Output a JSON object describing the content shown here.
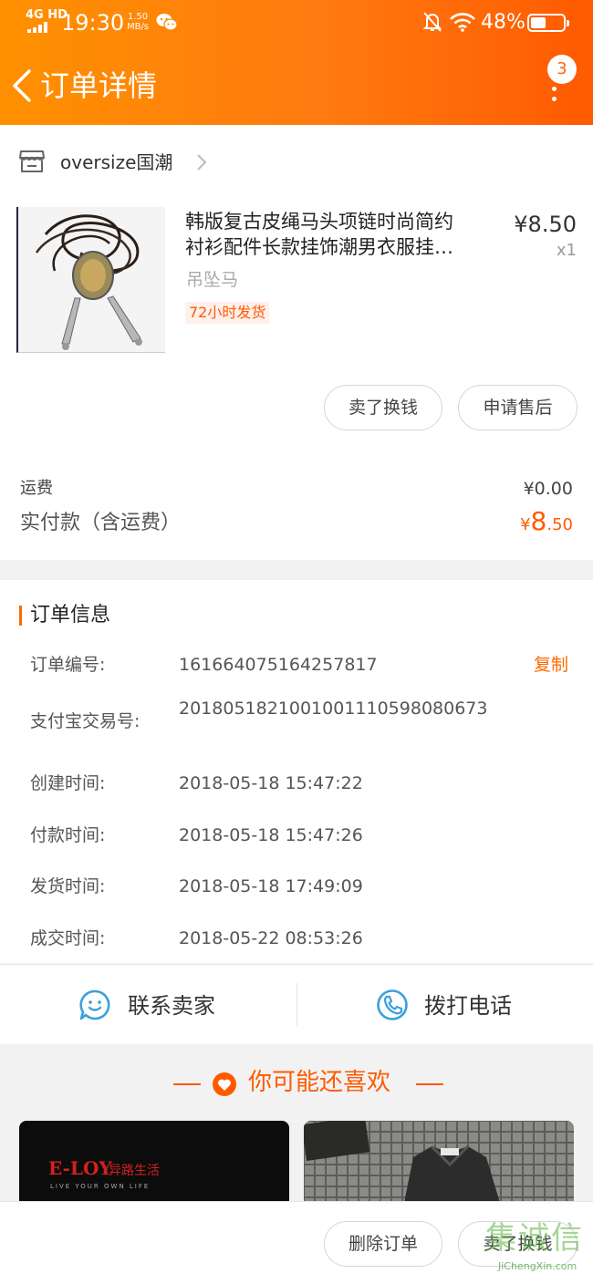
{
  "status_bar": {
    "network": "4G HD",
    "time": "19:30",
    "speed_value": "1.50",
    "speed_unit": "MB/s",
    "battery": "48%",
    "battery_level": 0.48
  },
  "nav": {
    "title": "订单详情",
    "badge": "3"
  },
  "shop": {
    "name": "oversize国潮"
  },
  "product": {
    "title_line1": "韩版复古皮绳马头项链时尚简约",
    "title_line2": "衬衫配件长款挂饰潮男衣服挂…",
    "price": "¥8.50",
    "quantity": "x1",
    "sku": "吊坠马",
    "tag": "72小时发货"
  },
  "actions": {
    "sell": "卖了换钱",
    "after_sales": "申请售后"
  },
  "summary": {
    "shipping_label": "运费",
    "shipping_value": "¥0.00",
    "paid_label": "实付款（含运费）",
    "paid_currency": "¥",
    "paid_int": "8",
    "paid_dec": ".50"
  },
  "order_info": {
    "heading": "订单信息",
    "copy_label": "复制",
    "rows": [
      {
        "label": "订单编号:",
        "value": "161664075164257817"
      },
      {
        "label": "支付宝交易号:",
        "value": "2018051821001001110598080673"
      },
      {
        "label": "创建时间:",
        "value": "2018-05-18 15:47:22"
      },
      {
        "label": "付款时间:",
        "value": "2018-05-18 15:47:26"
      },
      {
        "label": "发货时间:",
        "value": "2018-05-18 17:49:09"
      },
      {
        "label": "成交时间:",
        "value": "2018-05-22 08:53:26"
      }
    ]
  },
  "contact": {
    "seller": "联系卖家",
    "phone": "拨打电话"
  },
  "recommend": {
    "title": "你可能还喜欢",
    "tile1_brand": "E-LOY",
    "tile1_brand_cn": "异路生活",
    "tile1_slogan": "LIVE YOUR OWN LIFE"
  },
  "bottom": {
    "delete": "删除订单",
    "sell": "卖了换钱"
  },
  "watermark": {
    "text": "集诚信",
    "url": "JiChengXin.com"
  },
  "colors": {
    "accent": "#ff6a00",
    "header_start": "#ff9000",
    "header_end": "#ff5a00",
    "contact_icon": "#3aa0dc"
  }
}
